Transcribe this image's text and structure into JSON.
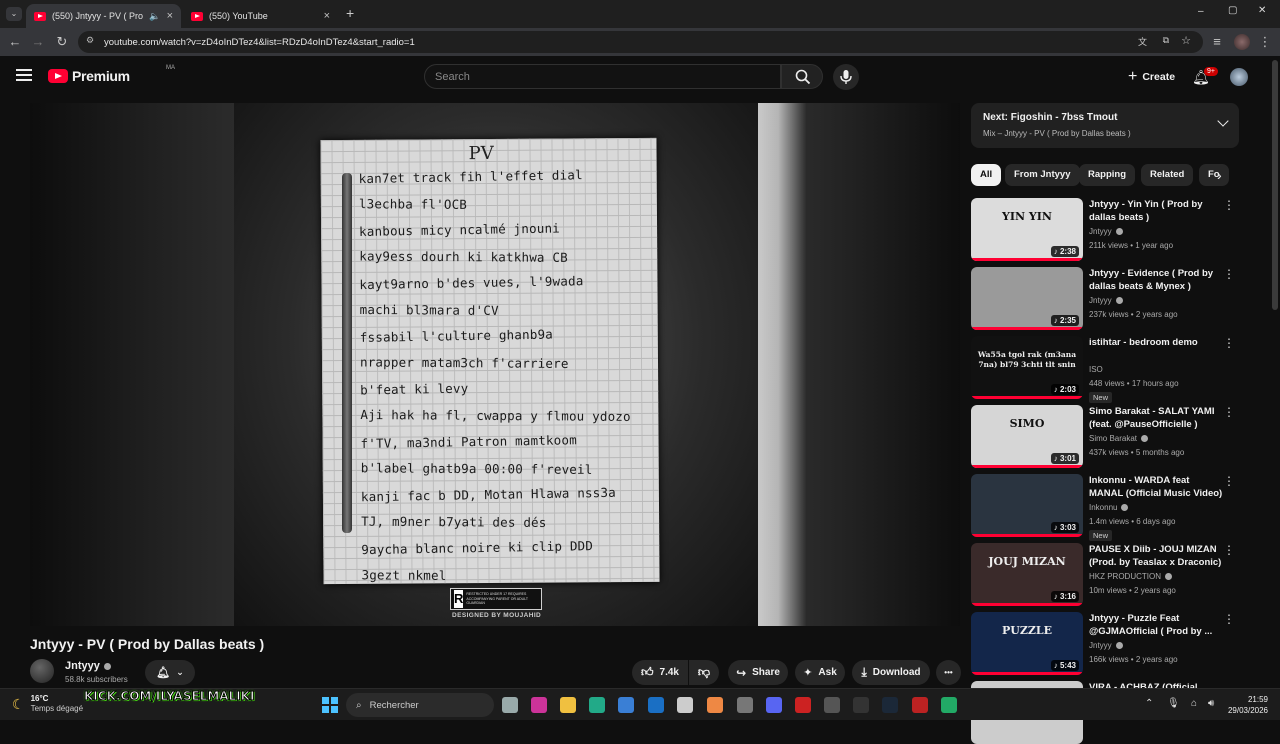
{
  "browser": {
    "tabs": [
      {
        "label": "(550) Jntyyy - PV ( Prod by Dalla",
        "active": true
      },
      {
        "label": "(550) YouTube",
        "active": false
      }
    ],
    "new_tab": "+",
    "url": "youtube.com/watch?v=zD4oInDTez4&list=RDzD4oInDTez4&start_radio=1",
    "window_controls": {
      "minimize": "–",
      "maximize": "▢",
      "close": "✕"
    }
  },
  "header": {
    "logo_text": "Premium",
    "country_code": "MA",
    "search_placeholder": "Search",
    "create_label": "Create",
    "notification_count": "9+"
  },
  "player": {
    "artwork_title": "PV",
    "lyrics": [
      "kan7et track fih l'effet dial",
      "l3echba fl'OCB",
      "kanbous micy ncalmé jnouni",
      "kay9ess dourh ki katkhwa CB",
      "kayt9arno b'des vues, l'9wada",
      "machi bl3mara d'CV",
      "fssabil l'culture ghanb9a",
      "nrapper matam3ch f'carriere",
      "b'feat ki levy",
      "Aji hak ha fl, cwappa y flmou ydozo",
      "f'TV, ma3ndi Patron mamtkoom",
      "b'label ghatb9a 00:00 f'reveil",
      "kanji fac b DD, Motan Hlawa nss3a",
      "TJ, m9ner b7yati des dés",
      "9aycha blanc noire ki clip DDD",
      "3gezt nkmel"
    ],
    "parental_label": "R",
    "parental_text": "RESTRICTED UNDER 17 REQUIRES ACCOMPANYING PARENT OR ADULT GUARDIAN",
    "designer_credit": "DESIGNED BY MOUJAHID"
  },
  "video": {
    "title": "Jntyyy - PV ( Prod by Dallas beats )",
    "channel": "Jntyyy",
    "subscribers": "58.8k subscribers",
    "likes": "7.4k",
    "share_label": "Share",
    "ask_label": "Ask",
    "download_label": "Download",
    "more_label": "•••"
  },
  "up_next": {
    "title": "Next: Figoshin - 7bss Tmout",
    "subtitle": "Mix – Jntyyy - PV ( Prod by Dallas beats )"
  },
  "chips": [
    "All",
    "From Jntyyy",
    "Rapping",
    "Related",
    "Fo"
  ],
  "recommendations": [
    {
      "title": "Jntyyy - Yin Yin ( Prod by dallas beats )",
      "channel": "Jntyyy",
      "verified": true,
      "meta": "211k views • 1 year ago",
      "duration": "2:38",
      "new": false,
      "thumb_text": "YIN YIN",
      "thumb_color": "#dcdcdc"
    },
    {
      "title": "Jntyyy - Evidence ( Prod by dallas beats & Mynex )",
      "channel": "Jntyyy",
      "verified": true,
      "meta": "237k views • 2 years ago",
      "duration": "2:35",
      "new": false,
      "thumb_text": "",
      "thumb_color": "#9a9a9a"
    },
    {
      "title": "istihtar - bedroom demo",
      "channel": "ISO",
      "verified": false,
      "meta": "448 views • 17 hours ago",
      "duration": "2:03",
      "new": true,
      "new_label": "New",
      "thumb_text": "Wa55a tgol rak (m3ana 7na) bl79 3chti tlt snin",
      "thumb_color": "#111111"
    },
    {
      "title": "Simo Barakat - SALAT YAMI (feat. @PauseOfficielle )",
      "channel": "Simo Barakat",
      "verified": true,
      "meta": "437k views • 5 months ago",
      "duration": "3:01",
      "new": false,
      "thumb_text": "SIMO",
      "thumb_color": "#d6d6d6"
    },
    {
      "title": "Inkonnu - WARDA feat MANAL (Official Music Video) - Prod.B...",
      "channel": "Inkonnu",
      "verified": true,
      "meta": "1.4m views • 6 days ago",
      "duration": "3:03",
      "new": true,
      "new_label": "New",
      "thumb_text": "",
      "thumb_color": "#2a3440"
    },
    {
      "title": "PAUSE X Diib - JOUJ MIZAN (Prod. by Teaslax x Draconic)",
      "channel": "HKZ PRODUCTION",
      "verified": true,
      "meta": "10m views • 2 years ago",
      "duration": "3:16",
      "new": false,
      "thumb_text": "JOUJ MIZAN",
      "thumb_color": "#3a2a2a"
    },
    {
      "title": "Jntyyy - Puzzle Feat @GJMAOfficial ( Prod by ...",
      "channel": "Jntyyy",
      "verified": true,
      "meta": "166k views • 2 years ago",
      "duration": "5:43",
      "new": false,
      "thumb_text": "PUZZLE",
      "thumb_color": "#13264a"
    },
    {
      "title": "VIRA - ACHBAZ (Official Music",
      "channel": "",
      "verified": false,
      "meta": "",
      "duration": "",
      "new": false,
      "thumb_text": "",
      "thumb_color": "#cccccc"
    }
  ],
  "taskbar": {
    "temperature": "16°C",
    "weather_text": "Temps dégagé",
    "overlay_text": "KICK.COM/ILYASELMALIKI",
    "search_label": "Rechercher",
    "time": "21:59",
    "date": "29/03/2026"
  },
  "colors": {
    "accent": "#ff0033",
    "background": "#0f0f0f",
    "chip_bg": "#272727"
  }
}
